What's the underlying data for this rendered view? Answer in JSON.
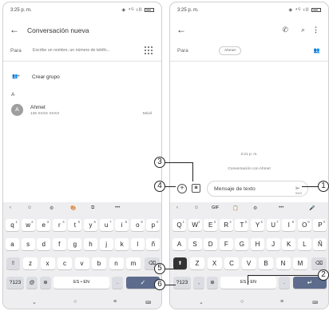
{
  "left": {
    "status": {
      "time": "3:25 p. m.",
      "signal": "◈ ⁴ᴳ ıll"
    },
    "appbar": {
      "title": "Conversación nueva"
    },
    "to": {
      "label": "Para",
      "placeholder": "Escribe un nombre, un número de teléfo..."
    },
    "group": {
      "icon": "👥+",
      "label": "Crear grupo"
    },
    "section": "A",
    "contact": {
      "initial": "A",
      "name": "Ahmet",
      "number": "135 XXXX XXXX",
      "type": "Móvil"
    }
  },
  "right": {
    "status": {
      "time": "3:25 p. m.",
      "signal": "◈ ⁴ᴳ ıll"
    },
    "to": {
      "label": "Para",
      "chip": "Ahmet"
    },
    "timestamp": "3:21 p. m.",
    "conversation_with": "Conversación con Ahmet",
    "compose": {
      "placeholder": "Mensaje de texto",
      "sms": "SMS"
    }
  },
  "keyboard_left": {
    "toolbar": [
      "‹",
      "☺",
      "⚙",
      "🎨",
      "⧉",
      "•••"
    ],
    "row1": [
      {
        "k": "q",
        "s": "1"
      },
      {
        "k": "w",
        "s": "2"
      },
      {
        "k": "e",
        "s": "3"
      },
      {
        "k": "r",
        "s": "4"
      },
      {
        "k": "t",
        "s": "5"
      },
      {
        "k": "y",
        "s": "6"
      },
      {
        "k": "u",
        "s": "7"
      },
      {
        "k": "i",
        "s": "8"
      },
      {
        "k": "o",
        "s": "9"
      },
      {
        "k": "p",
        "s": "0"
      }
    ],
    "row2": [
      "a",
      "s",
      "d",
      "f",
      "g",
      "h",
      "j",
      "k",
      "l",
      "ñ"
    ],
    "row3": [
      "z",
      "x",
      "c",
      "v",
      "b",
      "n",
      "m"
    ],
    "sym": "?123",
    "at": "@",
    "space": "ES • EN",
    "period": "."
  },
  "keyboard_right": {
    "toolbar": [
      "‹",
      "☺",
      "GIF",
      "📋",
      "⚙",
      "•••",
      "🎤"
    ],
    "row1": [
      {
        "k": "Q",
        "s": "1"
      },
      {
        "k": "W",
        "s": "2"
      },
      {
        "k": "E",
        "s": "3"
      },
      {
        "k": "R",
        "s": "4"
      },
      {
        "k": "T",
        "s": "5"
      },
      {
        "k": "Y",
        "s": "6"
      },
      {
        "k": "U",
        "s": "7"
      },
      {
        "k": "I",
        "s": "8"
      },
      {
        "k": "O",
        "s": "9"
      },
      {
        "k": "P",
        "s": "0"
      }
    ],
    "row2": [
      "A",
      "S",
      "D",
      "F",
      "G",
      "H",
      "J",
      "K",
      "L",
      "Ñ"
    ],
    "row3": [
      "Z",
      "X",
      "C",
      "V",
      "B",
      "N",
      "M"
    ],
    "sym": "?123",
    "comma": ",",
    "space": "ES • EN",
    "period": "."
  },
  "callouts": [
    "1",
    "2",
    "3",
    "4",
    "5",
    "6"
  ]
}
